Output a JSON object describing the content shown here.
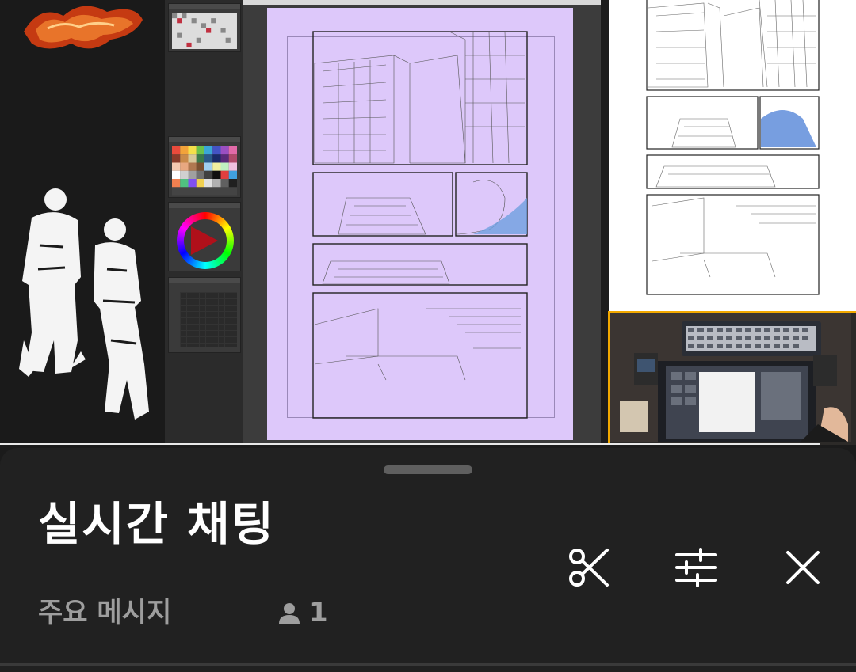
{
  "chat_panel": {
    "title": "실시간 채팅",
    "filter_label": "주요 메시지",
    "viewer_count": "1",
    "icons": [
      "scissors-icon",
      "tune-sliders-icon",
      "close-icon"
    ]
  },
  "video": {
    "accent_border_color": "#f2a900",
    "page_color": "#ddc8fa"
  }
}
